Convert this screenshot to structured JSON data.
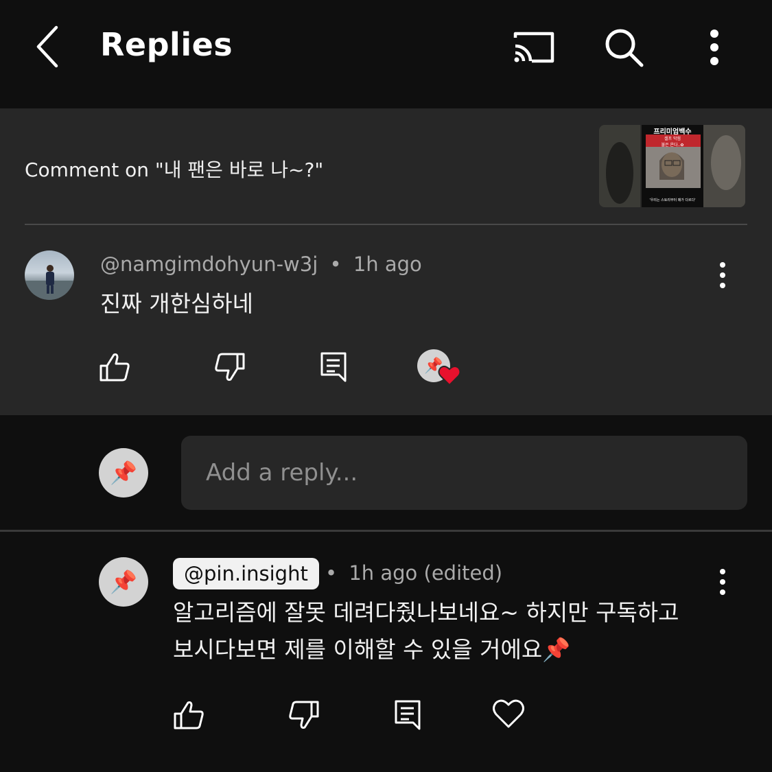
{
  "header": {
    "title": "Replies",
    "icons": [
      "back-arrow-icon",
      "cast-icon",
      "search-icon",
      "more-vertical-icon"
    ]
  },
  "parent": {
    "comment_on": "Comment on \"내 팬은 바로 나~?\"",
    "thumbnail_text": {
      "top": "프리미엄백수",
      "sub1": "셀프 막힘",
      "sub2": "불은 온다..✿",
      "bottom": "'우리는 스토리부터 매가 다르다'"
    }
  },
  "comment1": {
    "author": "@namgimdohyun-w3j",
    "separator": "•",
    "time": "1h ago",
    "text": "진짜 개한심하네"
  },
  "reply_box": {
    "placeholder": "Add a reply..."
  },
  "comment2": {
    "author": "@pin.insight",
    "separator": "•",
    "time": "1h ago (edited)",
    "text": "알고리즘에 잘못 데려다줬나보네요~ 하지만 구독하고 보시다보면 제를 이해할 수 있을 거에요📌"
  },
  "colors": {
    "background": "#0f0f0f",
    "surface": "#272727",
    "text": "#f1f1f1",
    "muted": "#aaaaaa",
    "heart": "#e8112d"
  }
}
